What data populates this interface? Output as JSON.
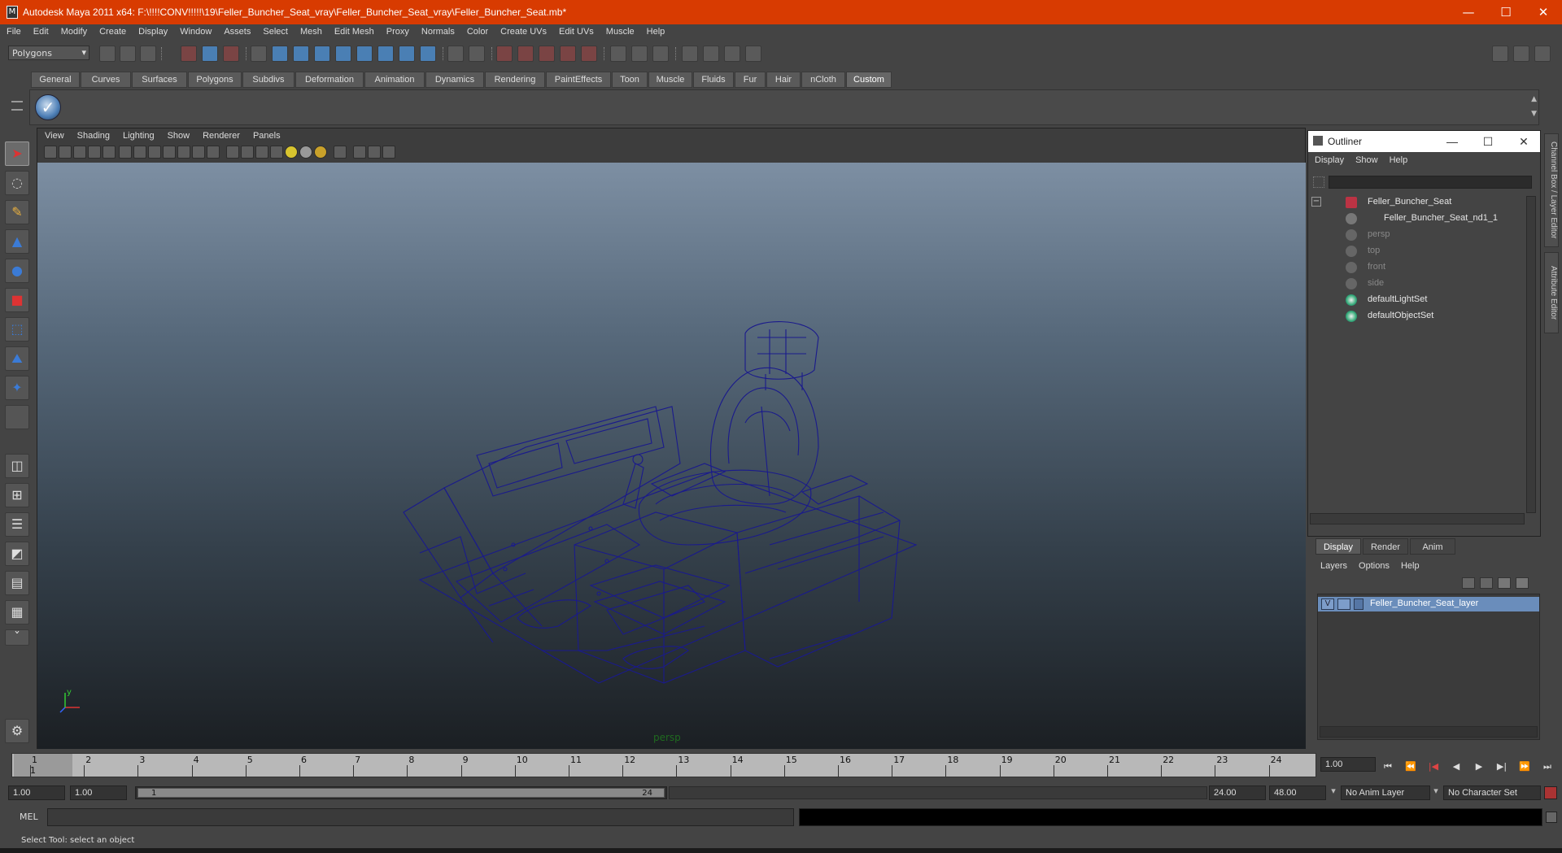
{
  "window": {
    "title": "Autodesk Maya 2011 x64: F:\\!!!!CONV!!!!!\\19\\Feller_Buncher_Seat_vray\\Feller_Buncher_Seat_vray\\Feller_Buncher_Seat.mb*",
    "minimize": "—",
    "maximize": "☐",
    "close": "✕"
  },
  "menubar": [
    "File",
    "Edit",
    "Modify",
    "Create",
    "Display",
    "Window",
    "Assets",
    "Select",
    "Mesh",
    "Edit Mesh",
    "Proxy",
    "Normals",
    "Color",
    "Create UVs",
    "Edit UVs",
    "Muscle",
    "Help"
  ],
  "statusline": {
    "mode": "Polygons"
  },
  "shelf": {
    "tabs": [
      "General",
      "Curves",
      "Surfaces",
      "Polygons",
      "Subdivs",
      "Deformation",
      "Animation",
      "Dynamics",
      "Rendering",
      "PaintEffects",
      "Toon",
      "Muscle",
      "Fluids",
      "Fur",
      "Hair",
      "nCloth",
      "Custom"
    ],
    "active_tab": "Custom",
    "item_glyph": "✓"
  },
  "viewport": {
    "menu": [
      "View",
      "Shading",
      "Lighting",
      "Show",
      "Renderer",
      "Panels"
    ],
    "camera_label": "persp",
    "wire_color": "#1a1a8c"
  },
  "outliner": {
    "title": "Outliner",
    "menu": [
      "Display",
      "Show",
      "Help"
    ],
    "items": [
      {
        "label": "Feller_Buncher_Seat",
        "dim": false
      },
      {
        "label": "Feller_Buncher_Seat_nd1_1",
        "dim": false
      },
      {
        "label": "persp",
        "dim": true
      },
      {
        "label": "top",
        "dim": true
      },
      {
        "label": "front",
        "dim": true
      },
      {
        "label": "side",
        "dim": true
      },
      {
        "label": "defaultLightSet",
        "dim": false
      },
      {
        "label": "defaultObjectSet",
        "dim": false
      }
    ]
  },
  "layer_editor": {
    "tabs": [
      "Display",
      "Render",
      "Anim"
    ],
    "active_tab": "Display",
    "menu": [
      "Layers",
      "Options",
      "Help"
    ],
    "layer": {
      "visible": "V",
      "name": "Feller_Buncher_Seat_layer"
    }
  },
  "side_tabs": [
    "Channel Box / Layer Editor",
    "Attribute Editor"
  ],
  "timeline": {
    "ticks": [
      "1",
      "2",
      "3",
      "4",
      "5",
      "6",
      "7",
      "8",
      "9",
      "10",
      "11",
      "12",
      "13",
      "14",
      "15",
      "16",
      "17",
      "18",
      "19",
      "20",
      "21",
      "22",
      "23",
      "24"
    ],
    "current_frame": "1",
    "current_time_field": "1.00",
    "playback_buttons": [
      "⏮",
      "⏪",
      "|◀",
      "◀",
      "▶",
      "▶|",
      "⏩",
      "⏭"
    ]
  },
  "range": {
    "start_field": "1.00",
    "start_field2": "1.00",
    "slider_start": "1",
    "slider_end": "24",
    "end_field": "24.00",
    "end_field2": "48.00",
    "anim_layer": "No Anim Layer",
    "character_set": "No Character Set"
  },
  "command": {
    "label": "MEL",
    "help": "Select Tool: select an object"
  },
  "colors": {
    "title_bg": "#d83b01",
    "ui_bg": "#444444",
    "selection": "#6a8dbb"
  }
}
